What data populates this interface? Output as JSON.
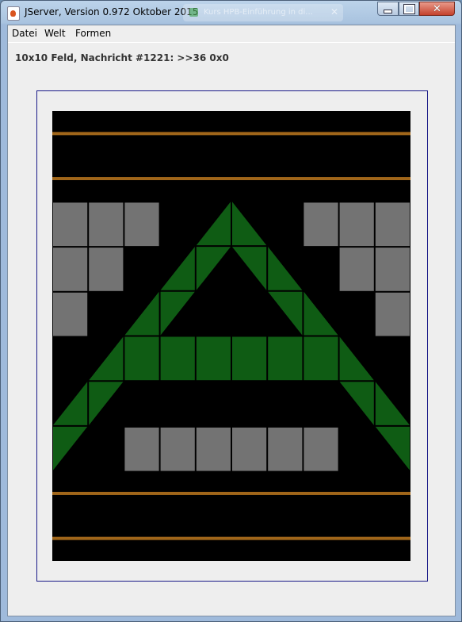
{
  "window": {
    "title": "JServer, Version 0.972 Oktober 2015",
    "background_tab": "Kurs HPB-Einführung in di..."
  },
  "menu": {
    "items": [
      "Datei",
      "Welt",
      "Formen"
    ]
  },
  "status": "10x10 Feld, Nachricht #1221: >>36 0x0",
  "board": {
    "cols": 10,
    "rows": 10,
    "background": "#000000",
    "colors": {
      "gray": "#737373",
      "green": "#0f5c14",
      "orange": "#a0661a"
    },
    "horizontal_lines_between_rows": [
      0,
      1,
      8,
      9
    ],
    "gray_cells": [
      [
        2,
        0
      ],
      [
        2,
        1
      ],
      [
        2,
        2
      ],
      [
        3,
        0
      ],
      [
        3,
        1
      ],
      [
        4,
        0
      ],
      [
        2,
        7
      ],
      [
        2,
        8
      ],
      [
        2,
        9
      ],
      [
        3,
        8
      ],
      [
        3,
        9
      ],
      [
        4,
        9
      ],
      [
        7,
        2
      ],
      [
        7,
        3
      ],
      [
        7,
        4
      ],
      [
        7,
        5
      ],
      [
        7,
        6
      ],
      [
        7,
        7
      ]
    ],
    "green_full_cells": [
      [
        5,
        2
      ],
      [
        5,
        3
      ],
      [
        5,
        4
      ],
      [
        5,
        5
      ],
      [
        5,
        6
      ],
      [
        5,
        7
      ]
    ],
    "green_triangles": [
      {
        "row": 2,
        "col": 4,
        "shape": "br"
      },
      {
        "row": 2,
        "col": 5,
        "shape": "bl"
      },
      {
        "row": 3,
        "col": 3,
        "shape": "br"
      },
      {
        "row": 3,
        "col": 4,
        "shape": "tl"
      },
      {
        "row": 3,
        "col": 5,
        "shape": "tr"
      },
      {
        "row": 3,
        "col": 6,
        "shape": "bl"
      },
      {
        "row": 4,
        "col": 2,
        "shape": "br"
      },
      {
        "row": 4,
        "col": 3,
        "shape": "tl"
      },
      {
        "row": 4,
        "col": 6,
        "shape": "tr"
      },
      {
        "row": 4,
        "col": 7,
        "shape": "bl"
      },
      {
        "row": 5,
        "col": 1,
        "shape": "br"
      },
      {
        "row": 5,
        "col": 8,
        "shape": "bl"
      },
      {
        "row": 6,
        "col": 0,
        "shape": "br"
      },
      {
        "row": 6,
        "col": 1,
        "shape": "tl"
      },
      {
        "row": 6,
        "col": 8,
        "shape": "tr"
      },
      {
        "row": 6,
        "col": 9,
        "shape": "bl"
      },
      {
        "row": 7,
        "col": 0,
        "shape": "tl"
      },
      {
        "row": 7,
        "col": 9,
        "shape": "tr"
      }
    ]
  }
}
